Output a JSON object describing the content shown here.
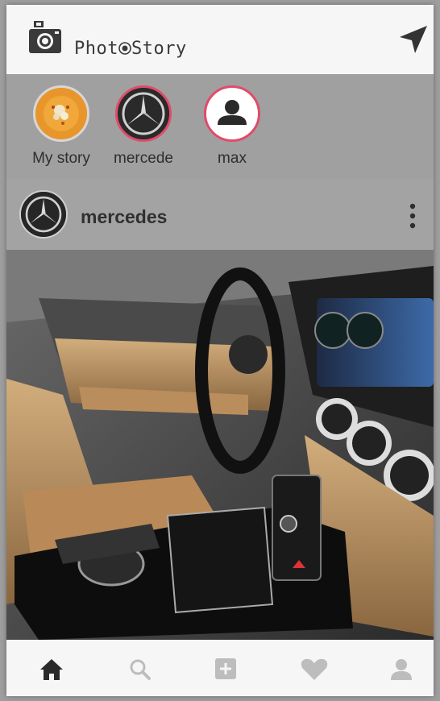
{
  "app": {
    "title_prefix": "Phot",
    "title_suffix": "Story",
    "logo_icon": "camera-icon",
    "action_icon": "navigation-arrow-icon"
  },
  "stories": [
    {
      "label": "My story",
      "avatar": "food-thumbnail",
      "ring_color": "#d7d7d7"
    },
    {
      "label": "mercede",
      "avatar": "mercedes-logo",
      "ring_color": "#e14b6b"
    },
    {
      "label": "max",
      "avatar": "person-icon",
      "ring_color": "#e14b6b"
    }
  ],
  "post": {
    "username": "mercedes",
    "avatar": "mercedes-logo",
    "menu_icon": "more-vertical-icon",
    "image": "car-interior-photo"
  },
  "bottom_nav": [
    {
      "icon": "home-icon",
      "active": true
    },
    {
      "icon": "search-icon",
      "active": false
    },
    {
      "icon": "add-icon",
      "active": false
    },
    {
      "icon": "heart-icon",
      "active": false
    },
    {
      "icon": "profile-icon",
      "active": false
    }
  ],
  "colors": {
    "story_ring_accent": "#e14b6b",
    "appbar_bg": "#f6f6f6",
    "overlay_bg": "#a3a3a3",
    "nav_active": "#2a2a2a",
    "nav_inactive": "#bdbdbd"
  }
}
